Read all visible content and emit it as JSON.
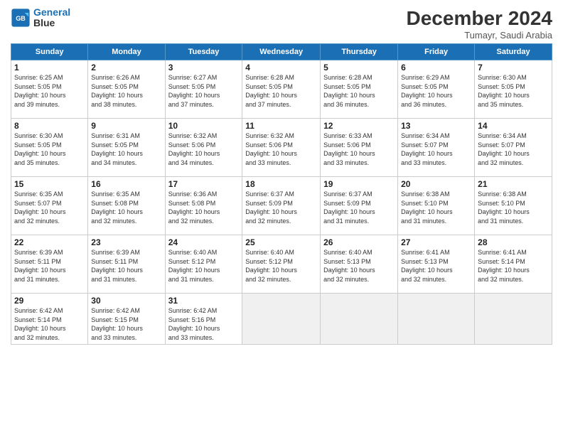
{
  "header": {
    "logo_line1": "General",
    "logo_line2": "Blue",
    "month": "December 2024",
    "location": "Tumayr, Saudi Arabia"
  },
  "weekdays": [
    "Sunday",
    "Monday",
    "Tuesday",
    "Wednesday",
    "Thursday",
    "Friday",
    "Saturday"
  ],
  "weeks": [
    [
      {
        "day": "1",
        "info": "Sunrise: 6:25 AM\nSunset: 5:05 PM\nDaylight: 10 hours\nand 39 minutes."
      },
      {
        "day": "2",
        "info": "Sunrise: 6:26 AM\nSunset: 5:05 PM\nDaylight: 10 hours\nand 38 minutes."
      },
      {
        "day": "3",
        "info": "Sunrise: 6:27 AM\nSunset: 5:05 PM\nDaylight: 10 hours\nand 37 minutes."
      },
      {
        "day": "4",
        "info": "Sunrise: 6:28 AM\nSunset: 5:05 PM\nDaylight: 10 hours\nand 37 minutes."
      },
      {
        "day": "5",
        "info": "Sunrise: 6:28 AM\nSunset: 5:05 PM\nDaylight: 10 hours\nand 36 minutes."
      },
      {
        "day": "6",
        "info": "Sunrise: 6:29 AM\nSunset: 5:05 PM\nDaylight: 10 hours\nand 36 minutes."
      },
      {
        "day": "7",
        "info": "Sunrise: 6:30 AM\nSunset: 5:05 PM\nDaylight: 10 hours\nand 35 minutes."
      }
    ],
    [
      {
        "day": "8",
        "info": "Sunrise: 6:30 AM\nSunset: 5:05 PM\nDaylight: 10 hours\nand 35 minutes."
      },
      {
        "day": "9",
        "info": "Sunrise: 6:31 AM\nSunset: 5:05 PM\nDaylight: 10 hours\nand 34 minutes."
      },
      {
        "day": "10",
        "info": "Sunrise: 6:32 AM\nSunset: 5:06 PM\nDaylight: 10 hours\nand 34 minutes."
      },
      {
        "day": "11",
        "info": "Sunrise: 6:32 AM\nSunset: 5:06 PM\nDaylight: 10 hours\nand 33 minutes."
      },
      {
        "day": "12",
        "info": "Sunrise: 6:33 AM\nSunset: 5:06 PM\nDaylight: 10 hours\nand 33 minutes."
      },
      {
        "day": "13",
        "info": "Sunrise: 6:34 AM\nSunset: 5:07 PM\nDaylight: 10 hours\nand 33 minutes."
      },
      {
        "day": "14",
        "info": "Sunrise: 6:34 AM\nSunset: 5:07 PM\nDaylight: 10 hours\nand 32 minutes."
      }
    ],
    [
      {
        "day": "15",
        "info": "Sunrise: 6:35 AM\nSunset: 5:07 PM\nDaylight: 10 hours\nand 32 minutes."
      },
      {
        "day": "16",
        "info": "Sunrise: 6:35 AM\nSunset: 5:08 PM\nDaylight: 10 hours\nand 32 minutes."
      },
      {
        "day": "17",
        "info": "Sunrise: 6:36 AM\nSunset: 5:08 PM\nDaylight: 10 hours\nand 32 minutes."
      },
      {
        "day": "18",
        "info": "Sunrise: 6:37 AM\nSunset: 5:09 PM\nDaylight: 10 hours\nand 32 minutes."
      },
      {
        "day": "19",
        "info": "Sunrise: 6:37 AM\nSunset: 5:09 PM\nDaylight: 10 hours\nand 31 minutes."
      },
      {
        "day": "20",
        "info": "Sunrise: 6:38 AM\nSunset: 5:10 PM\nDaylight: 10 hours\nand 31 minutes."
      },
      {
        "day": "21",
        "info": "Sunrise: 6:38 AM\nSunset: 5:10 PM\nDaylight: 10 hours\nand 31 minutes."
      }
    ],
    [
      {
        "day": "22",
        "info": "Sunrise: 6:39 AM\nSunset: 5:11 PM\nDaylight: 10 hours\nand 31 minutes."
      },
      {
        "day": "23",
        "info": "Sunrise: 6:39 AM\nSunset: 5:11 PM\nDaylight: 10 hours\nand 31 minutes."
      },
      {
        "day": "24",
        "info": "Sunrise: 6:40 AM\nSunset: 5:12 PM\nDaylight: 10 hours\nand 31 minutes."
      },
      {
        "day": "25",
        "info": "Sunrise: 6:40 AM\nSunset: 5:12 PM\nDaylight: 10 hours\nand 32 minutes."
      },
      {
        "day": "26",
        "info": "Sunrise: 6:40 AM\nSunset: 5:13 PM\nDaylight: 10 hours\nand 32 minutes."
      },
      {
        "day": "27",
        "info": "Sunrise: 6:41 AM\nSunset: 5:13 PM\nDaylight: 10 hours\nand 32 minutes."
      },
      {
        "day": "28",
        "info": "Sunrise: 6:41 AM\nSunset: 5:14 PM\nDaylight: 10 hours\nand 32 minutes."
      }
    ],
    [
      {
        "day": "29",
        "info": "Sunrise: 6:42 AM\nSunset: 5:14 PM\nDaylight: 10 hours\nand 32 minutes."
      },
      {
        "day": "30",
        "info": "Sunrise: 6:42 AM\nSunset: 5:15 PM\nDaylight: 10 hours\nand 33 minutes."
      },
      {
        "day": "31",
        "info": "Sunrise: 6:42 AM\nSunset: 5:16 PM\nDaylight: 10 hours\nand 33 minutes."
      },
      null,
      null,
      null,
      null
    ]
  ]
}
